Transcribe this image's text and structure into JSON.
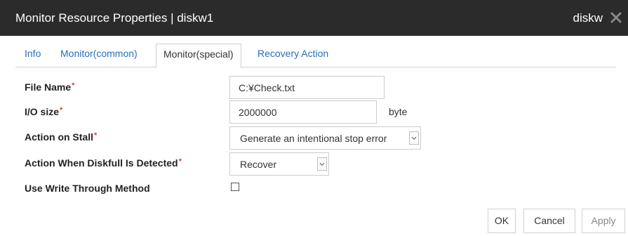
{
  "window": {
    "title": "Monitor Resource Properties | diskw1",
    "title_right": "diskw",
    "close_icon": "close-icon"
  },
  "tabs": [
    {
      "label": "Info",
      "active": false
    },
    {
      "label": "Monitor(common)",
      "active": false
    },
    {
      "label": "Monitor(special)",
      "active": true
    },
    {
      "label": "Recovery Action",
      "active": false
    }
  ],
  "form": {
    "required_mark": "*",
    "file_name": {
      "label": "File Name",
      "value": "C:¥Check.txt"
    },
    "io_size": {
      "label": "I/O size",
      "value": "2000000",
      "unit": "byte"
    },
    "action_on_stall": {
      "label": "Action on Stall",
      "value": "Generate an intentional stop error"
    },
    "action_diskfull": {
      "label": "Action When Diskfull Is Detected",
      "value": "Recover"
    },
    "write_through": {
      "label": "Use Write Through Method",
      "checked": false
    }
  },
  "buttons": {
    "ok": "OK",
    "cancel": "Cancel",
    "apply": "Apply"
  },
  "colors": {
    "titlebar": "#2b2b2b",
    "tab_link": "#2a6ebb",
    "required": "#e53935"
  }
}
